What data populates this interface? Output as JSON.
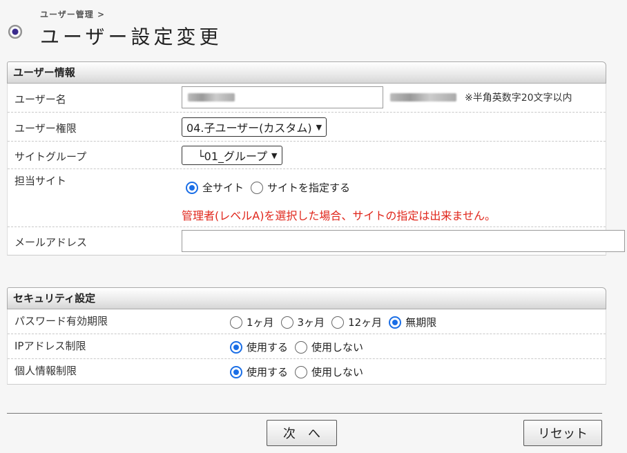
{
  "header": {
    "breadcrumb": "ユーザー管理 >",
    "title": "ユーザー設定変更"
  },
  "user_section": {
    "title": "ユーザー情報",
    "rows": {
      "username": {
        "label": "ユーザー名",
        "note": "※半角英数字20文字以内"
      },
      "authority": {
        "label": "ユーザー権限",
        "selected": "04.子ユーザー(カスタム)"
      },
      "site_group": {
        "label": "サイトグループ",
        "selected": "└01_グループ"
      },
      "site": {
        "label": "担当サイト",
        "options": [
          "全サイト",
          "サイトを指定する"
        ],
        "warning": "管理者(レベルA)を選択した場合、サイトの指定は出来ません。"
      },
      "email": {
        "label": "メールアドレス",
        "value": ""
      }
    }
  },
  "security_section": {
    "title": "セキュリティ設定",
    "rows": {
      "password_expiry": {
        "label": "パスワード有効期限",
        "options": [
          "1ヶ月",
          "3ヶ月",
          "12ヶ月",
          "無期限"
        ]
      },
      "ip_restriction": {
        "label": "IPアドレス制限",
        "options": [
          "使用する",
          "使用しない"
        ]
      },
      "personal_info": {
        "label": "個人情報制限",
        "options": [
          "使用する",
          "使用しない"
        ]
      }
    }
  },
  "buttons": {
    "next": "次　へ",
    "reset": "リセット"
  },
  "colors": {
    "warning": "#e0261b",
    "radio_accent": "#1a6ee6"
  },
  "icons": {
    "header": "radio-bullet-icon",
    "dropdown": "chevron-down-icon"
  }
}
